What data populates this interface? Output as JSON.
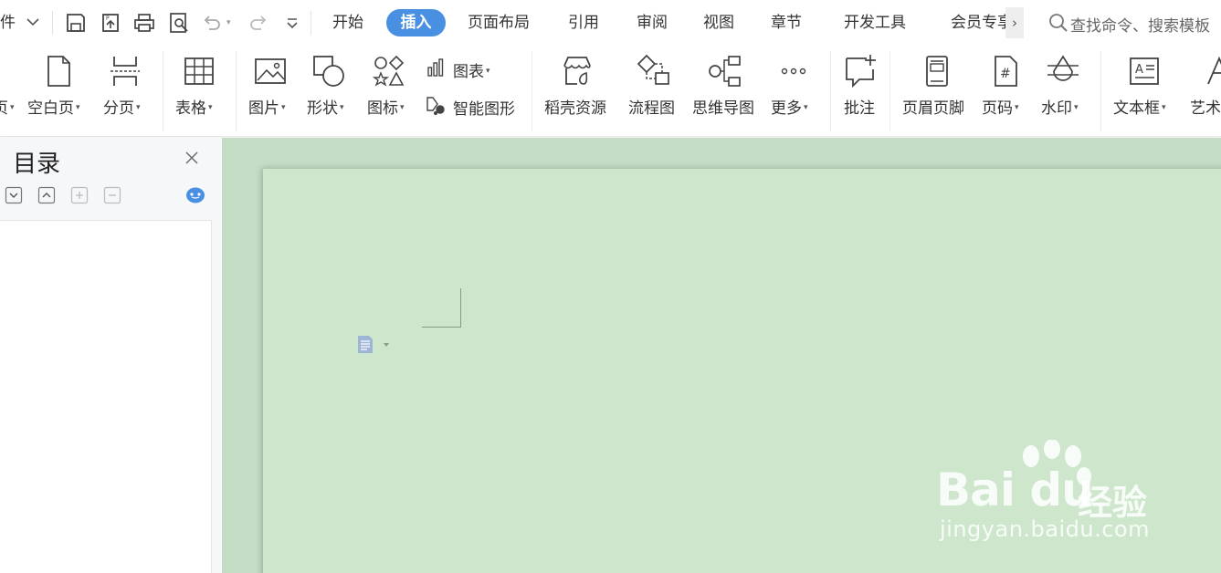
{
  "menubar": {
    "file_label": "件",
    "tabs": [
      {
        "label": "开始"
      },
      {
        "label": "插入"
      },
      {
        "label": "页面布局"
      },
      {
        "label": "引用"
      },
      {
        "label": "审阅"
      },
      {
        "label": "视图"
      },
      {
        "label": "章节"
      },
      {
        "label": "开发工具"
      },
      {
        "label": "会员专享"
      }
    ],
    "active_tab": "插入",
    "more_tabs_glyph": "›",
    "search_placeholder": "查找命令、搜索模板"
  },
  "ribbon": {
    "cover_label": "页",
    "blank_page_label": "空白页",
    "page_break_label": "分页",
    "table_label": "表格",
    "picture_label": "图片",
    "shape_label": "形状",
    "icons_label": "图标",
    "chart_label": "图表",
    "smart_art_label": "智能图形",
    "resources_label": "稻壳资源",
    "flowchart_label": "流程图",
    "mindmap_label": "思维导图",
    "more_label": "更多",
    "comment_label": "批注",
    "header_footer_label": "页眉页脚",
    "page_number_label": "页码",
    "watermark_label": "水印",
    "textbox_label": "文本框",
    "wordart_label": "艺术"
  },
  "toc": {
    "title": "目录"
  },
  "watermark": {
    "logo": "Bai  du",
    "brand": "经验",
    "url": "jingyan.baidu.com"
  },
  "colors": {
    "accent": "#4a90e2",
    "canvas_bg": "#c4dcc4",
    "page_bg": "#cde6cc"
  }
}
